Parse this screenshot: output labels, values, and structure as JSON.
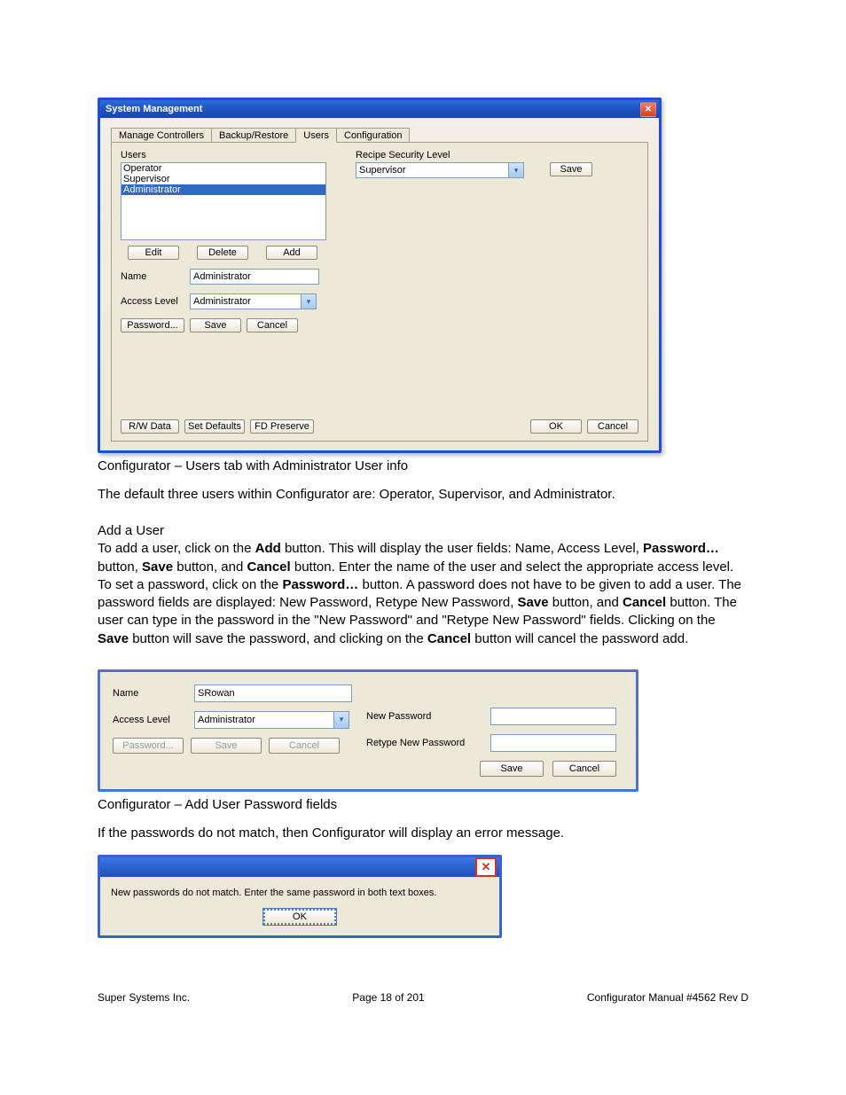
{
  "window1": {
    "title": "System Management",
    "tabs": [
      "Manage Controllers",
      "Backup/Restore",
      "Users",
      "Configuration"
    ],
    "active_tab": "Users",
    "users_label": "Users",
    "users_list": [
      "Operator",
      "Supervisor",
      "Administrator"
    ],
    "selected_user": "Administrator",
    "btn_edit": "Edit",
    "btn_delete": "Delete",
    "btn_add": "Add",
    "field_name_label": "Name",
    "field_name_value": "Administrator",
    "field_access_label": "Access Level",
    "field_access_value": "Administrator",
    "btn_password": "Password...",
    "btn_save": "Save",
    "btn_cancel": "Cancel",
    "recipe_sec_label": "Recipe Security Level",
    "recipe_sec_value": "Supervisor",
    "recipe_save": "Save",
    "bottom": {
      "rw": "R/W Data",
      "defaults": "Set Defaults",
      "fd": "FD Preserve",
      "ok": "OK",
      "cancel": "Cancel"
    }
  },
  "caption1": "Configurator – Users tab with Administrator User info",
  "para1": "The default three users within Configurator are: Operator, Supervisor, and Administrator.",
  "section_add": "Add a User",
  "para2_parts": {
    "a": "To add a user, click on the ",
    "add": "Add",
    "b": " button.  This will display the user fields: Name, Access Level, ",
    "pw": "Password…",
    "c": " button, ",
    "save1": "Save",
    "d": " button, and ",
    "cancel1": "Cancel",
    "e": " button.  Enter the name of the user and select the appropriate access level.  To set a password, click on the ",
    "pw2": "Password…",
    "f": " button.  A password does not have to be given to add a user.  The password fields are displayed: New Password, Retype New Password, ",
    "save2": "Save",
    "g": " button, and ",
    "cancel2": "Cancel",
    "h": " button.  The user can type in the password in the \"New Password\" and \"Retype New Password\" fields.  Clicking on the ",
    "save3": "Save",
    "i": " button will save the password, and clicking on the ",
    "cancel3": "Cancel",
    "j": " button will cancel the password add."
  },
  "panel2": {
    "name_label": "Name",
    "name_value": "SRowan",
    "access_label": "Access Level",
    "access_value": "Administrator",
    "btn_password": "Password...",
    "btn_save": "Save",
    "btn_cancel": "Cancel",
    "npw_label": "New Password",
    "rpw_label": "Retype New Password",
    "btn_save2": "Save",
    "btn_cancel2": "Cancel"
  },
  "caption2": "Configurator – Add User Password fields",
  "para3": "If the passwords do not match, then Configurator will display an error message.",
  "msgbox": {
    "text": "New passwords do not match.  Enter the same password in both text boxes.",
    "ok": "OK"
  },
  "footer": {
    "left": "Super Systems Inc.",
    "center": "Page 18 of 201",
    "right": "Configurator Manual #4562 Rev D"
  }
}
